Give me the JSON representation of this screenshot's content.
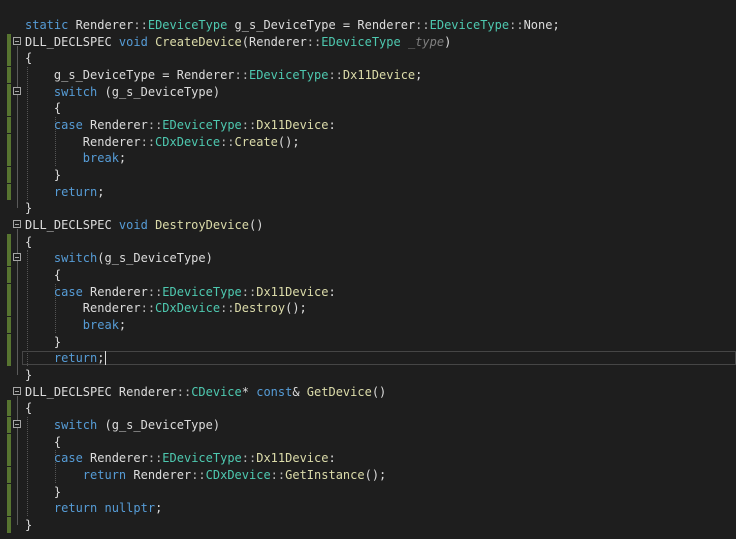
{
  "editor": {
    "lines": [
      {
        "tokens": [
          {
            "t": "static",
            "k": "kw"
          },
          {
            "t": " Renderer",
            "k": "pl"
          },
          {
            "t": "::",
            "k": "op"
          },
          {
            "t": "EDeviceType",
            "k": "ty"
          },
          {
            "t": " g_s_DeviceType = Renderer",
            "k": "pl"
          },
          {
            "t": "::",
            "k": "op"
          },
          {
            "t": "EDeviceType",
            "k": "ty"
          },
          {
            "t": "::",
            "k": "op"
          },
          {
            "t": "None",
            "k": "pl"
          },
          {
            "t": ";",
            "k": "pl"
          }
        ]
      },
      {
        "tokens": [
          {
            "t": "DLL_DECLSPEC",
            "k": "pl"
          },
          {
            "t": " void ",
            "k": "kw"
          },
          {
            "t": "CreateDevice",
            "k": "fn"
          },
          {
            "t": "(Renderer",
            "k": "pl"
          },
          {
            "t": "::",
            "k": "op"
          },
          {
            "t": "EDeviceType",
            "k": "ty"
          },
          {
            "t": " _type",
            "k": "pm"
          },
          {
            "t": ")",
            "k": "pl"
          }
        ]
      },
      {
        "tokens": [
          {
            "t": "{",
            "k": "pl"
          }
        ]
      },
      {
        "tokens": [
          {
            "t": "    g_s_DeviceType = Renderer",
            "k": "pl"
          },
          {
            "t": "::",
            "k": "op"
          },
          {
            "t": "EDeviceType",
            "k": "ty"
          },
          {
            "t": "::",
            "k": "op"
          },
          {
            "t": "Dx11Device",
            "k": "fn"
          },
          {
            "t": ";",
            "k": "pl"
          }
        ]
      },
      {
        "tokens": [
          {
            "t": "    ",
            "k": "pl"
          },
          {
            "t": "switch",
            "k": "kw"
          },
          {
            "t": " (g_s_DeviceType)",
            "k": "pl"
          }
        ]
      },
      {
        "tokens": [
          {
            "t": "    {",
            "k": "pl"
          }
        ]
      },
      {
        "tokens": [
          {
            "t": "    ",
            "k": "pl"
          },
          {
            "t": "case",
            "k": "kw"
          },
          {
            "t": " Renderer",
            "k": "pl"
          },
          {
            "t": "::",
            "k": "op"
          },
          {
            "t": "EDeviceType",
            "k": "ty"
          },
          {
            "t": "::",
            "k": "op"
          },
          {
            "t": "Dx11Device",
            "k": "fn"
          },
          {
            "t": ":",
            "k": "pl"
          }
        ]
      },
      {
        "tokens": [
          {
            "t": "        Renderer",
            "k": "pl"
          },
          {
            "t": "::",
            "k": "op"
          },
          {
            "t": "CDxDevice",
            "k": "ty"
          },
          {
            "t": "::",
            "k": "op"
          },
          {
            "t": "Create",
            "k": "fn"
          },
          {
            "t": "();",
            "k": "pl"
          }
        ]
      },
      {
        "tokens": [
          {
            "t": "        ",
            "k": "pl"
          },
          {
            "t": "break",
            "k": "kw"
          },
          {
            "t": ";",
            "k": "pl"
          }
        ]
      },
      {
        "tokens": [
          {
            "t": "    }",
            "k": "pl"
          }
        ]
      },
      {
        "tokens": [
          {
            "t": "    ",
            "k": "pl"
          },
          {
            "t": "return",
            "k": "kw"
          },
          {
            "t": ";",
            "k": "pl"
          }
        ]
      },
      {
        "tokens": [
          {
            "t": "}",
            "k": "pl"
          }
        ]
      },
      {
        "tokens": [
          {
            "t": "DLL_DECLSPEC",
            "k": "pl"
          },
          {
            "t": " void ",
            "k": "kw"
          },
          {
            "t": "DestroyDevice",
            "k": "fn"
          },
          {
            "t": "()",
            "k": "pl"
          }
        ]
      },
      {
        "tokens": [
          {
            "t": "{",
            "k": "pl"
          }
        ]
      },
      {
        "tokens": [
          {
            "t": "    ",
            "k": "pl"
          },
          {
            "t": "switch",
            "k": "kw"
          },
          {
            "t": "(g_s_DeviceType)",
            "k": "pl"
          }
        ]
      },
      {
        "tokens": [
          {
            "t": "    {",
            "k": "pl"
          }
        ]
      },
      {
        "tokens": [
          {
            "t": "    ",
            "k": "pl"
          },
          {
            "t": "case",
            "k": "kw"
          },
          {
            "t": " Renderer",
            "k": "pl"
          },
          {
            "t": "::",
            "k": "op"
          },
          {
            "t": "EDeviceType",
            "k": "ty"
          },
          {
            "t": "::",
            "k": "op"
          },
          {
            "t": "Dx11Device",
            "k": "fn"
          },
          {
            "t": ":",
            "k": "pl"
          }
        ]
      },
      {
        "tokens": [
          {
            "t": "        Renderer",
            "k": "pl"
          },
          {
            "t": "::",
            "k": "op"
          },
          {
            "t": "CDxDevice",
            "k": "ty"
          },
          {
            "t": "::",
            "k": "op"
          },
          {
            "t": "Destroy",
            "k": "fn"
          },
          {
            "t": "();",
            "k": "pl"
          }
        ]
      },
      {
        "tokens": [
          {
            "t": "        ",
            "k": "pl"
          },
          {
            "t": "break",
            "k": "kw"
          },
          {
            "t": ";",
            "k": "pl"
          }
        ]
      },
      {
        "tokens": [
          {
            "t": "    }",
            "k": "pl"
          }
        ]
      },
      {
        "tokens": [
          {
            "t": "    ",
            "k": "pl"
          },
          {
            "t": "return",
            "k": "kw"
          },
          {
            "t": ";",
            "k": "pl"
          }
        ]
      },
      {
        "tokens": [
          {
            "t": "}",
            "k": "pl"
          }
        ]
      },
      {
        "tokens": [
          {
            "t": "DLL_DECLSPEC",
            "k": "pl"
          },
          {
            "t": " Renderer",
            "k": "pl"
          },
          {
            "t": "::",
            "k": "op"
          },
          {
            "t": "CDevice",
            "k": "ty"
          },
          {
            "t": "* ",
            "k": "pl"
          },
          {
            "t": "const",
            "k": "kw"
          },
          {
            "t": "& ",
            "k": "pl"
          },
          {
            "t": "GetDevice",
            "k": "fn"
          },
          {
            "t": "()",
            "k": "pl"
          }
        ]
      },
      {
        "tokens": [
          {
            "t": "{",
            "k": "pl"
          }
        ]
      },
      {
        "tokens": [
          {
            "t": "    ",
            "k": "pl"
          },
          {
            "t": "switch",
            "k": "kw"
          },
          {
            "t": " (g_s_DeviceType)",
            "k": "pl"
          }
        ]
      },
      {
        "tokens": [
          {
            "t": "    {",
            "k": "pl"
          }
        ]
      },
      {
        "tokens": [
          {
            "t": "    ",
            "k": "pl"
          },
          {
            "t": "case",
            "k": "kw"
          },
          {
            "t": " Renderer",
            "k": "pl"
          },
          {
            "t": "::",
            "k": "op"
          },
          {
            "t": "EDeviceType",
            "k": "ty"
          },
          {
            "t": "::",
            "k": "op"
          },
          {
            "t": "Dx11Device",
            "k": "fn"
          },
          {
            "t": ":",
            "k": "pl"
          }
        ]
      },
      {
        "tokens": [
          {
            "t": "        ",
            "k": "pl"
          },
          {
            "t": "return",
            "k": "kw"
          },
          {
            "t": " Renderer",
            "k": "pl"
          },
          {
            "t": "::",
            "k": "op"
          },
          {
            "t": "CDxDevice",
            "k": "ty"
          },
          {
            "t": "::",
            "k": "op"
          },
          {
            "t": "GetInstance",
            "k": "fn"
          },
          {
            "t": "();",
            "k": "pl"
          }
        ]
      },
      {
        "tokens": [
          {
            "t": "    }",
            "k": "pl"
          }
        ]
      },
      {
        "tokens": [
          {
            "t": "    ",
            "k": "pl"
          },
          {
            "t": "return",
            "k": "kw"
          },
          {
            "t": " nullptr",
            "k": "kw"
          },
          {
            "t": ";",
            "k": "pl"
          }
        ]
      },
      {
        "tokens": [
          {
            "t": "}",
            "k": "pl"
          }
        ]
      }
    ]
  },
  "theme": {
    "background": "#1e1e1e",
    "keyword": "#569cd6",
    "type": "#4ec9b0",
    "function": "#dcdcaa",
    "plain": "#dcdcdc",
    "param": "#7f7f7f",
    "change_bar": "#577430"
  }
}
